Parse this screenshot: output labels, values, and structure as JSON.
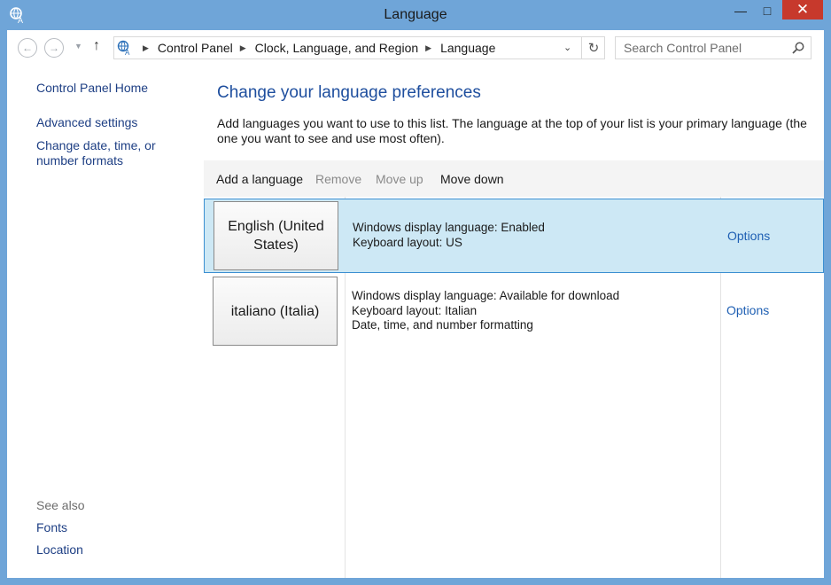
{
  "window": {
    "title": "Language",
    "controls": {
      "minimize": "—",
      "maximize": "□",
      "close": "✕"
    }
  },
  "address_bar": {
    "breadcrumbs": [
      "Control Panel",
      "Clock, Language, and Region",
      "Language"
    ],
    "search_placeholder": "Search Control Panel"
  },
  "sidebar": {
    "home": "Control Panel Home",
    "links": [
      "Advanced settings",
      "Change date, time, or number formats"
    ],
    "see_also_label": "See also",
    "see_also_links": [
      "Fonts",
      "Location"
    ]
  },
  "main": {
    "heading": "Change your language preferences",
    "description": "Add languages you want to use to this list. The language at the top of your list is your primary language (the one you want to see and use most often).",
    "toolbar": {
      "add": "Add a language",
      "remove": "Remove",
      "move_up": "Move up",
      "move_down": "Move down"
    },
    "languages": [
      {
        "name": "English (United States)",
        "details": [
          "Windows display language: Enabled",
          "Keyboard layout: US"
        ],
        "options": "Options",
        "selected": true
      },
      {
        "name": "italiano (Italia)",
        "details": [
          "Windows display language: Available for download",
          "Keyboard layout: Italian",
          "Date, time, and number formatting"
        ],
        "options": "Options",
        "selected": false
      }
    ]
  },
  "colors": {
    "frame": "#6fa5d8",
    "link": "#1e3f84",
    "heading": "#1e4e9e",
    "selection": "#cde8f5",
    "close": "#c7392c"
  }
}
